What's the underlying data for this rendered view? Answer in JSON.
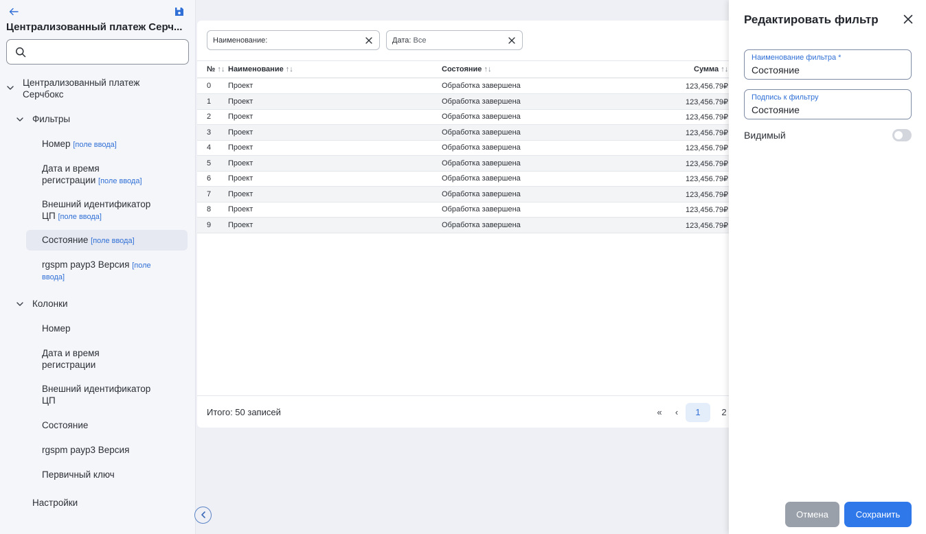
{
  "sidebar": {
    "title": "Централизованный платеж Серч...",
    "search": {
      "value": "",
      "placeholder": ""
    },
    "root": {
      "label_line1": "Централизованный платеж",
      "label_line2": "Серчбокс"
    },
    "filters_group": {
      "label": "Фильтры",
      "items": [
        {
          "line1": "Номер",
          "hint": "[поле ввода]"
        },
        {
          "line1": "Дата и время",
          "line2": "регистрации",
          "hint": "[поле ввода]"
        },
        {
          "line1": "Внешний идентификатор",
          "line2": "ЦП",
          "hint": "[поле ввода]"
        },
        {
          "line1": "Состояние",
          "hint": "[поле ввода]"
        },
        {
          "line1": "rgspm payp3 Версия",
          "hint_a": "[поле",
          "hint_b": "ввода]"
        }
      ]
    },
    "columns_group": {
      "label": "Колонки",
      "items": [
        {
          "line1": "Номер"
        },
        {
          "line1": "Дата и время",
          "line2": "регистрации"
        },
        {
          "line1": "Внешний идентификатор",
          "line2": "ЦП"
        },
        {
          "line1": "Состояние"
        },
        {
          "line1": "rgspm payp3 Версия"
        },
        {
          "line1": "Первичный ключ"
        }
      ]
    },
    "settings_label": "Настройки"
  },
  "filters_bar": {
    "chips": [
      {
        "label": "Наименование:",
        "value": ""
      },
      {
        "label": "Дата:",
        "value": "Все"
      }
    ]
  },
  "table": {
    "sort_glyph": "↑↓",
    "columns": [
      "№",
      "Наименование",
      "Состояние",
      "Сумма"
    ],
    "rows": [
      {
        "num": "0",
        "name": "Проект",
        "status": "Обработка завершена",
        "sum": "123,456.79₽"
      },
      {
        "num": "1",
        "name": "Проект",
        "status": "Обработка завершена",
        "sum": "123,456.79₽"
      },
      {
        "num": "2",
        "name": "Проект",
        "status": "Обработка завершена",
        "sum": "123,456.79₽"
      },
      {
        "num": "3",
        "name": "Проект",
        "status": "Обработка завершена",
        "sum": "123,456.79₽"
      },
      {
        "num": "4",
        "name": "Проект",
        "status": "Обработка завершена",
        "sum": "123,456.79₽"
      },
      {
        "num": "5",
        "name": "Проект",
        "status": "Обработка завершена",
        "sum": "123,456.79₽"
      },
      {
        "num": "6",
        "name": "Проект",
        "status": "Обработка завершена",
        "sum": "123,456.79₽"
      },
      {
        "num": "7",
        "name": "Проект",
        "status": "Обработка завершена",
        "sum": "123,456.79₽"
      },
      {
        "num": "8",
        "name": "Проект",
        "status": "Обработка завершена",
        "sum": "123,456.79₽"
      },
      {
        "num": "9",
        "name": "Проект",
        "status": "Обработка завершена",
        "sum": "123,456.79₽"
      }
    ],
    "total_label": "Итого: 50 записей",
    "pagination": {
      "first": "«",
      "prev": "‹",
      "current": "1",
      "next_page": "2"
    }
  },
  "edit_panel": {
    "title": "Редактировать фильтр",
    "name_field": {
      "label": "Наименование фильтра *",
      "value": "Состояние"
    },
    "caption_field": {
      "label": "Подпись к фильтру",
      "value": "Состояние"
    },
    "visible_label": "Видимый",
    "visible_on": false,
    "cancel_label": "Отмена",
    "save_label": "Сохранить"
  },
  "colors": {
    "accent": "#2f78ea",
    "link": "#2f6fd6",
    "cancel": "#99a0aa",
    "selected_bg": "#e6e9f1"
  },
  "icons": [
    "back-arrow-icon",
    "save-icon",
    "search-icon",
    "chevron-down-icon",
    "close-icon",
    "chevron-left-icon"
  ]
}
